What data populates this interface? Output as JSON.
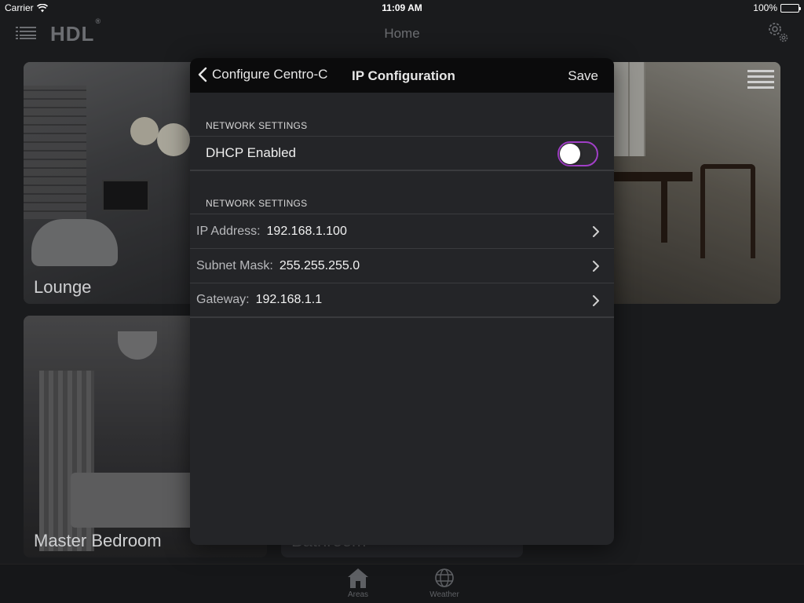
{
  "status_bar": {
    "carrier": "Carrier",
    "time": "11:09 AM",
    "battery": "100%"
  },
  "header": {
    "brand": "HDL",
    "brand_mark": "®",
    "title": "Home"
  },
  "areas": [
    {
      "label": "Lounge"
    },
    {
      "label": "Master Bedroom"
    },
    {
      "label": "Bathroom"
    }
  ],
  "tab_bar": {
    "tabs": [
      {
        "label": "Areas",
        "icon": "home-icon"
      },
      {
        "label": "Weather",
        "icon": "globe-icon"
      }
    ]
  },
  "modal": {
    "back_label": "Configure Centro-C",
    "title": "IP Configuration",
    "save_label": "Save",
    "sections": [
      {
        "header": "NETWORK SETTINGS",
        "rows": [
          {
            "label": "DHCP Enabled",
            "type": "switch",
            "value": false
          }
        ]
      },
      {
        "header": "NETWORK SETTINGS",
        "rows": [
          {
            "label": "IP Address:",
            "value": "192.168.1.100"
          },
          {
            "label": "Subnet Mask:",
            "value": "255.255.255.0"
          },
          {
            "label": "Gateway:",
            "value": "192.168.1.1"
          }
        ]
      }
    ]
  },
  "colors": {
    "accent": "#a13fc7",
    "background": "#1a1b1d",
    "panel": "#242528",
    "nav": "#0b0b0c"
  }
}
